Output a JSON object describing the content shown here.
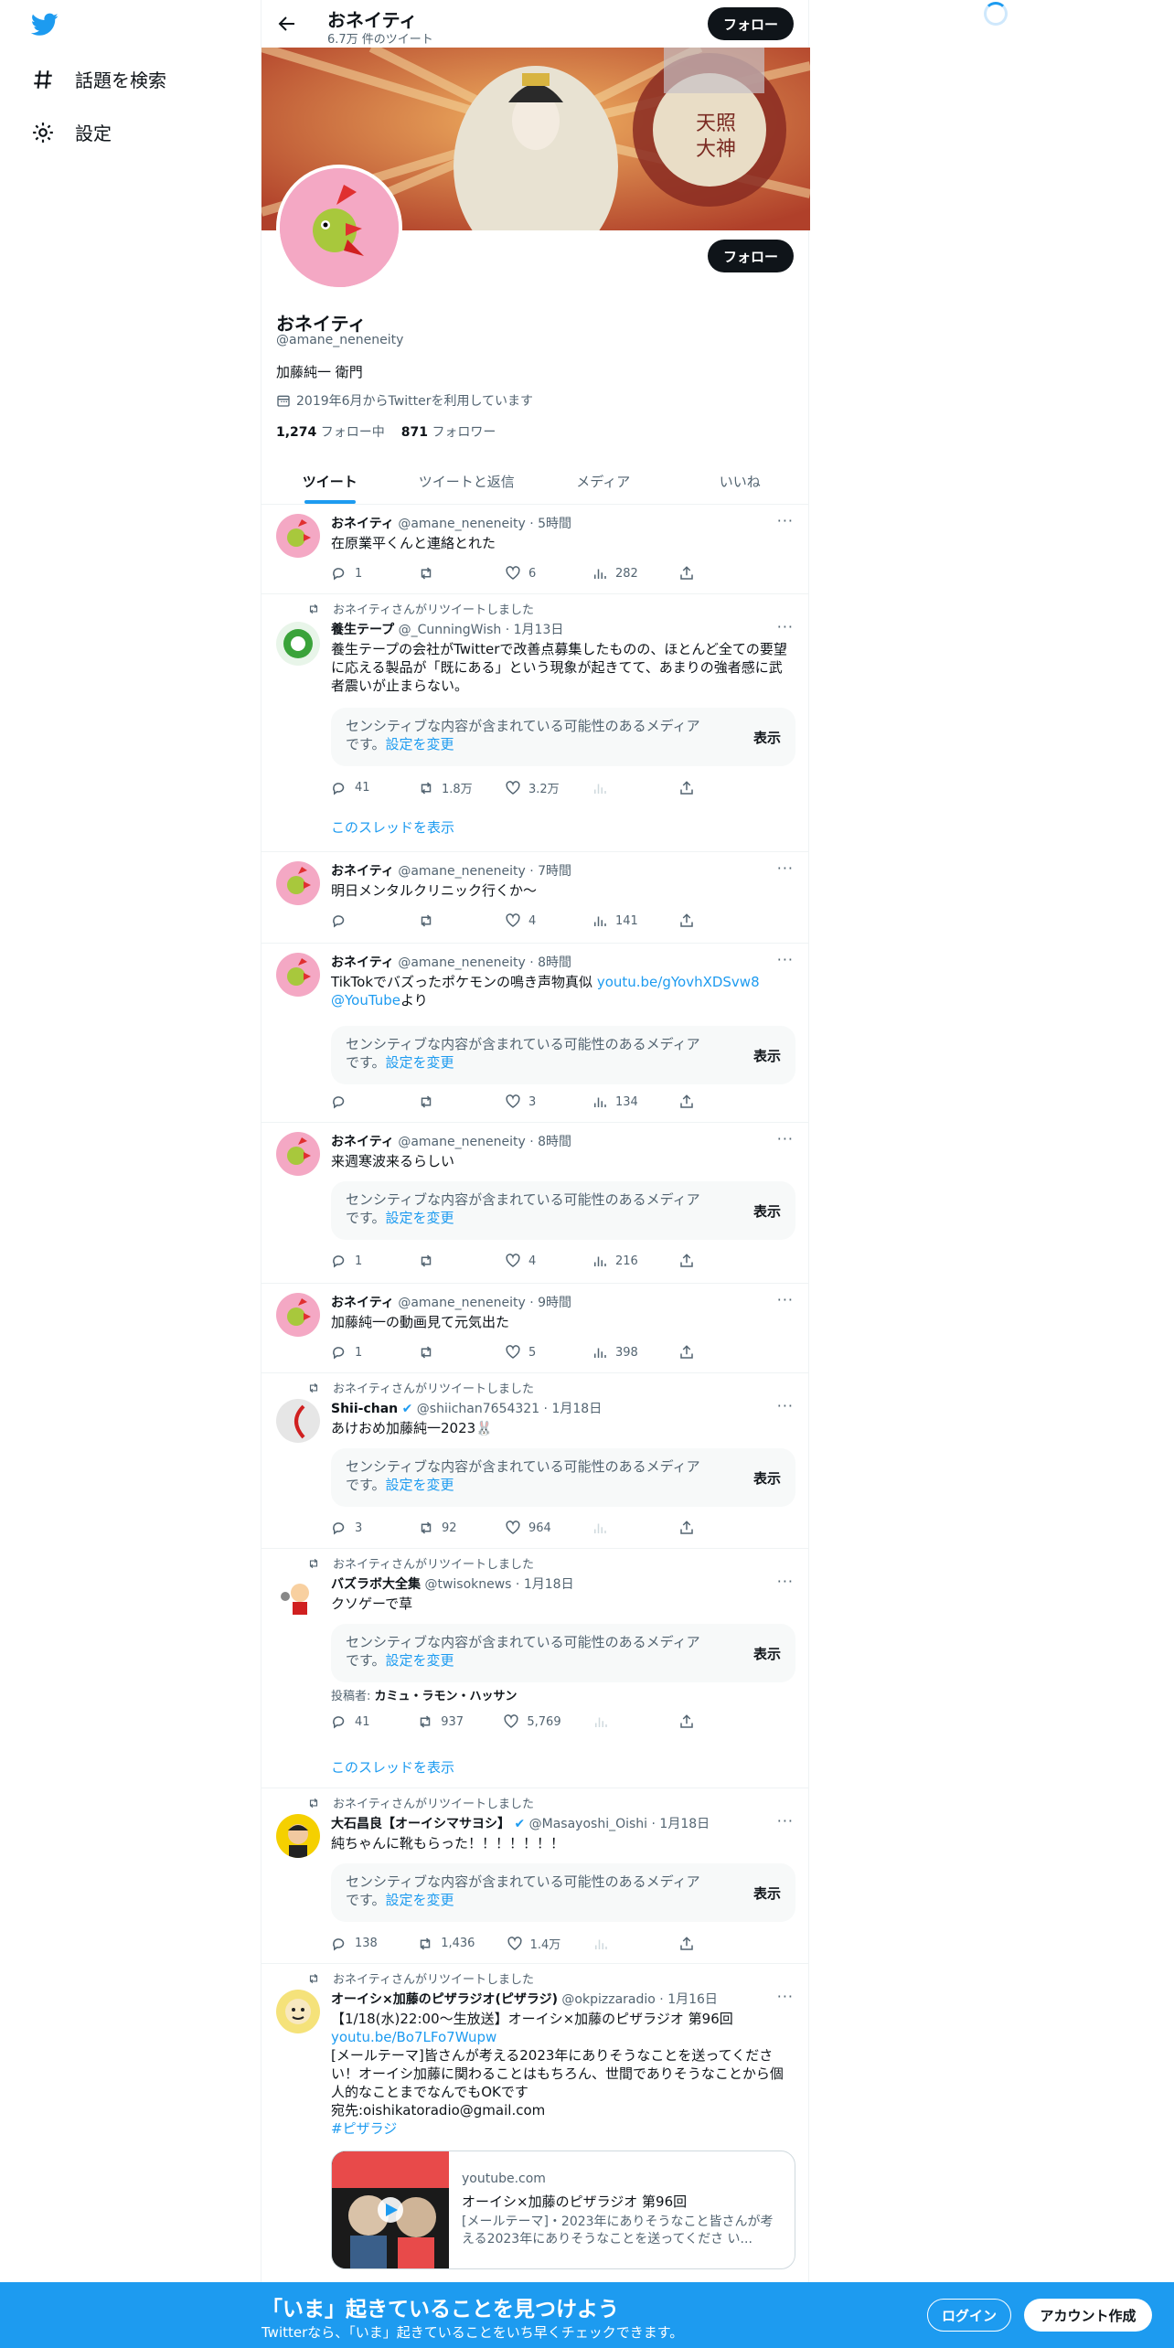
{
  "sidebar": {
    "explore": "話題を検索",
    "settings": "設定"
  },
  "topbar": {
    "name": "おネイティ",
    "tweet_count": "6.7万 件のツイート",
    "follow": "フォロー"
  },
  "profile": {
    "name": "おネイティ",
    "handle": "@amane_neneneity",
    "bio": "加藤純一 衛門",
    "joined": "2019年6月からTwitterを利用しています",
    "following_count": "1,274",
    "following_label": "フォロー中",
    "followers_count": "871",
    "followers_label": "フォロワー",
    "follow": "フォロー"
  },
  "tabs": [
    "ツイート",
    "ツイートと返信",
    "メディア",
    "いいね"
  ],
  "common": {
    "retweeted": "おネイティさんがリツイートしました",
    "sensitive": "センシティブな内容が含まれている可能性のあるメディアです。",
    "change_settings": "設定を変更",
    "show": "表示",
    "show_thread": "このスレッドを表示"
  },
  "tweets": [
    {
      "name": "おネイティ",
      "handle": "@amane_neneneity",
      "time": "5時間",
      "text": "在原業平くんと連絡とれた",
      "reply": "1",
      "rt": "",
      "like": "6",
      "views": "282"
    },
    {
      "name": "養生テープ",
      "handle": "@_CunningWish",
      "time": "1月13日",
      "text": "養生テープの会社がTwitterで改善点募集したものの、ほとんど全ての要望に応える製品が「既にある」という現象が起きてて、あまりの強者感に武者震いが止まらない。",
      "reply": "41",
      "rt": "1.8万",
      "like": "3.2万",
      "views": ""
    },
    {
      "name": "おネイティ",
      "handle": "@amane_neneneity",
      "time": "7時間",
      "text": "明日メンタルクリニック行くか〜",
      "reply": "",
      "rt": "",
      "like": "4",
      "views": "141"
    },
    {
      "name": "おネイティ",
      "handle": "@amane_neneneity",
      "time": "8時間",
      "text": "TikTokでバズったポケモンの鳴き声物真似 ",
      "link": "youtu.be/gYovhXDSvw8",
      "mention": "@YouTube",
      "suffix": "より",
      "reply": "",
      "rt": "",
      "like": "3",
      "views": "134"
    },
    {
      "name": "おネイティ",
      "handle": "@amane_neneneity",
      "time": "8時間",
      "text": "来週寒波来るらしい",
      "reply": "1",
      "rt": "",
      "like": "4",
      "views": "216"
    },
    {
      "name": "おネイティ",
      "handle": "@amane_neneneity",
      "time": "9時間",
      "text": "加藤純一の動画見て元気出た",
      "reply": "1",
      "rt": "",
      "like": "5",
      "views": "398"
    },
    {
      "name": "Shii-chan",
      "handle": "@shiichan7654321",
      "time": "1月18日",
      "text": "あけおめ加藤純一2023🐰",
      "reply": "3",
      "rt": "92",
      "like": "964",
      "views": ""
    },
    {
      "name": "バズラボ大全集",
      "handle": "@twisoknews",
      "time": "1月18日",
      "text": "クソゲーで草",
      "poster_label": "投稿者:",
      "poster": "カミュ・ラモン・ハッサン",
      "reply": "41",
      "rt": "937",
      "like": "5,769",
      "views": ""
    },
    {
      "name": "大石昌良【オーイシマサヨシ】",
      "handle": "@Masayoshi_Oishi",
      "time": "1月18日",
      "text": "純ちゃんに靴もらった！！！！！！！",
      "reply": "138",
      "rt": "1,436",
      "like": "1.4万",
      "views": ""
    },
    {
      "name": "オーイシ×加藤のピザラジオ(ピザラジ)",
      "handle": "@okpizzaradio",
      "time": "1月16日",
      "line1": "【1/18(水)22:00〜生放送】オーイシ×加藤のピザラジオ 第96回",
      "link": "youtu.be/Bo7LFo7Wupw",
      "line2": "[メールテーマ]皆さんが考える2023年にありそうなことを送ってください！オーイシ加藤に関わることはもちろん、世間でありそうなことから個人的なことまでなんでもOKです",
      "line3": "宛先:oishikatoradio@gmail.com",
      "hashtag": "#ピザラジ",
      "card": {
        "domain": "youtube.com",
        "title": "オーイシ×加藤のピザラジオ 第96回",
        "desc": "[メールテーマ]・2023年にありそうなこと皆さんが考える2023年にありそうなことを送ってくださ い..."
      }
    }
  ],
  "bottom_bar": {
    "title": "「いま」起きていることを見つけよう",
    "subtitle": "Twitterなら、「いま」起きていることをいち早くチェックできます。",
    "login": "ログイン",
    "signup": "アカウント作成"
  },
  "colors": {
    "accent": "#1d9bf0",
    "text": "#0f1419",
    "muted": "#536471"
  }
}
